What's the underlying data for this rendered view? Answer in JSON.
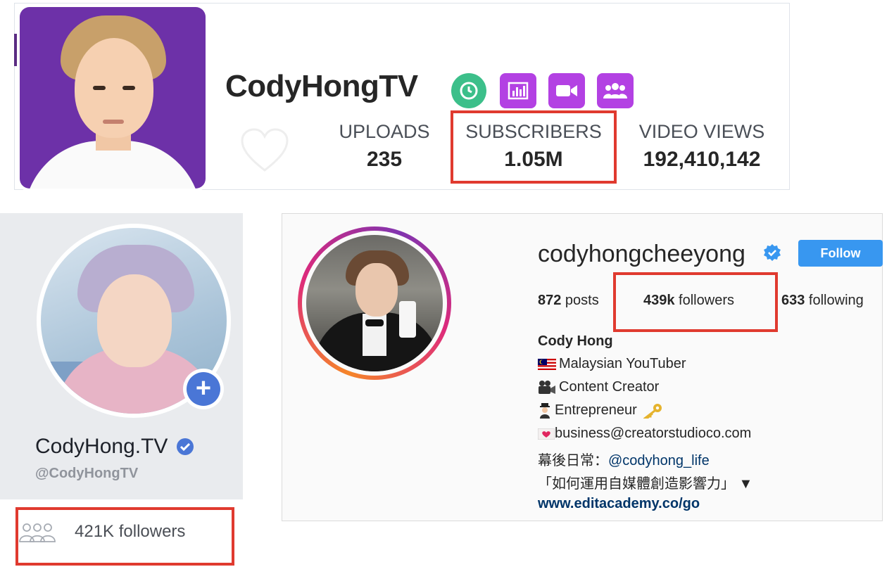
{
  "youtube": {
    "channel_name": "CodyHongTV",
    "badges": [
      "clock-icon",
      "chart-icon",
      "video-camera-icon",
      "users-icon"
    ],
    "badge_colors": {
      "clock": "#3cbf8a",
      "others": "#b341e3"
    },
    "stats": [
      {
        "label": "UPLOADS",
        "value": "235"
      },
      {
        "label": "SUBSCRIBERS",
        "value": "1.05M"
      },
      {
        "label": "VIDEO VIEWS",
        "value": "192,410,142"
      }
    ]
  },
  "facebook": {
    "page_name": "CodyHong.TV",
    "handle": "@CodyHongTV",
    "followers_text": "421K followers"
  },
  "instagram": {
    "username": "codyhongcheeyong",
    "follow_button": "Follow",
    "posts_count": "872",
    "posts_label": " posts",
    "followers_count": "439k",
    "followers_label": " followers",
    "following_count": "633",
    "following_label": " following",
    "full_name": "Cody Hong",
    "bio": {
      "line1": "Malaysian YouTuber",
      "line2": "Content Creator",
      "line3": "Entrepreneur",
      "line4": "business@creatorstudioco.com",
      "line5_prefix": "幕後日常：",
      "line5_mention": "@codyhong_life",
      "line6": "「如何運用自媒體創造影響力」 ▼"
    },
    "website": "www.editacademy.co/go"
  },
  "highlight_color": "#e03a2f"
}
